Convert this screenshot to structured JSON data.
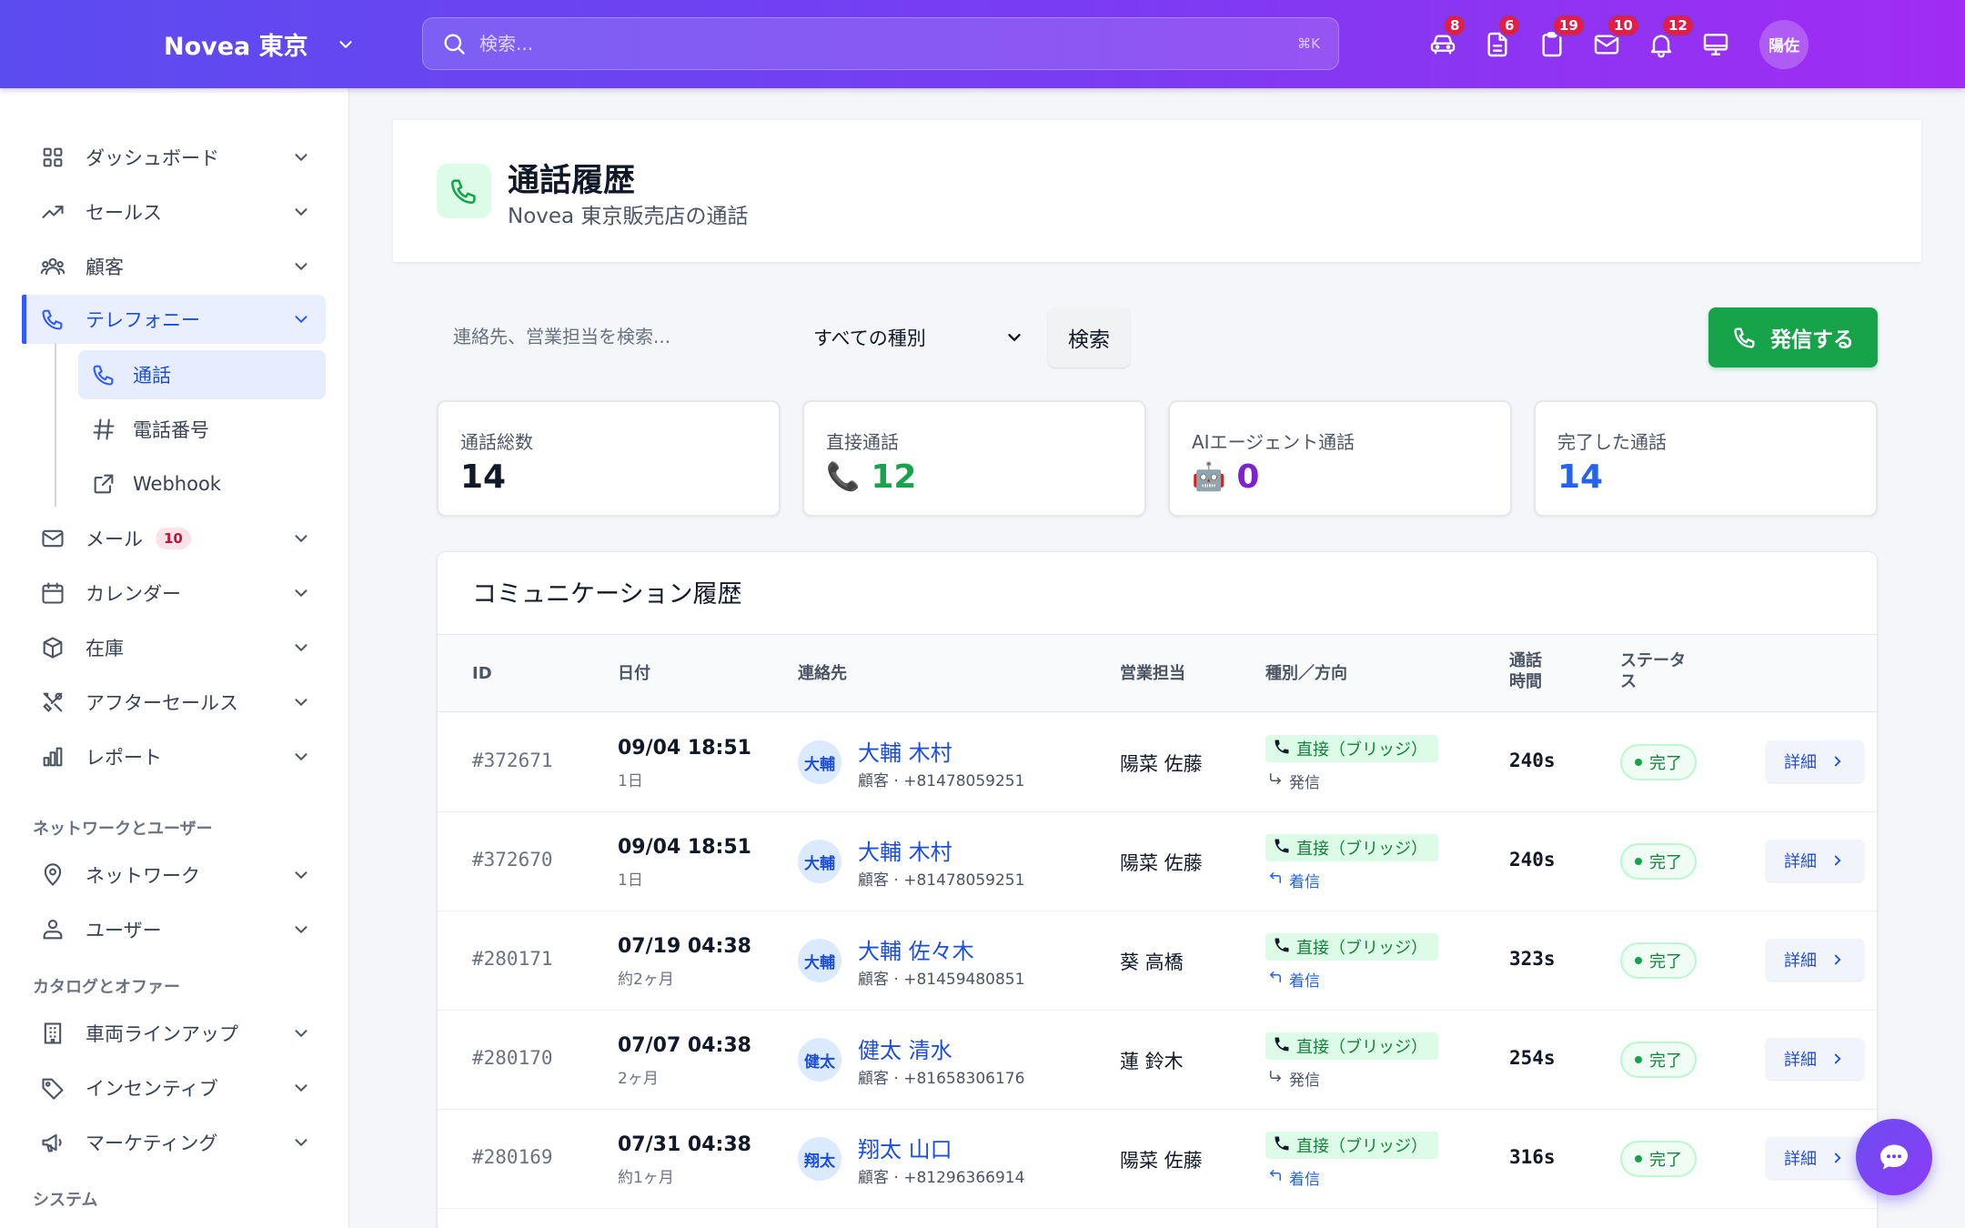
{
  "topbar": {
    "brand": "Novea 東京",
    "search_placeholder": "検索...",
    "shortcut": "⌘K",
    "icons": [
      {
        "name": "car-icon",
        "badge": "8"
      },
      {
        "name": "document-icon",
        "badge": "6"
      },
      {
        "name": "clipboard-icon",
        "badge": "19"
      },
      {
        "name": "mail-icon",
        "badge": "10"
      },
      {
        "name": "bell-icon",
        "badge": "12"
      },
      {
        "name": "monitor-icon",
        "badge": ""
      }
    ],
    "user_initials": "陽佐"
  },
  "sidebar": {
    "items": [
      {
        "label": "ダッシュボード",
        "icon": "grid-icon"
      },
      {
        "label": "セールス",
        "icon": "trending-up-icon"
      },
      {
        "label": "顧客",
        "icon": "users-icon"
      },
      {
        "label": "テレフォニー",
        "icon": "phone-icon",
        "active": true
      },
      {
        "label": "メール",
        "icon": "mail-icon",
        "badge": "10"
      },
      {
        "label": "カレンダー",
        "icon": "calendar-icon"
      },
      {
        "label": "在庫",
        "icon": "box-icon"
      },
      {
        "label": "アフターセールス",
        "icon": "tools-icon"
      },
      {
        "label": "レポート",
        "icon": "bar-chart-icon"
      },
      {
        "label": "ネットワーク",
        "icon": "map-pin-icon"
      },
      {
        "label": "ユーザー",
        "icon": "user-group-icon"
      },
      {
        "label": "車両ラインアップ",
        "icon": "building-icon"
      },
      {
        "label": "インセンティブ",
        "icon": "tag-icon"
      },
      {
        "label": "マーケティング",
        "icon": "megaphone-icon"
      }
    ],
    "sub_items": [
      {
        "label": "通話",
        "icon": "phone-icon",
        "active": true
      },
      {
        "label": "電話番号",
        "icon": "hash-icon"
      },
      {
        "label": "Webhook",
        "icon": "external-link-icon"
      }
    ],
    "sections": [
      "ネットワークとユーザー",
      "カタログとオファー",
      "システム"
    ]
  },
  "page": {
    "title": "通話履歴",
    "subtitle": "Novea 東京販売店の通話"
  },
  "filters": {
    "search_placeholder": "連絡先、営業担当を検索...",
    "type_select": "すべての種別",
    "search_button": "検索",
    "call_button": "発信する"
  },
  "stats": [
    {
      "label": "通話総数",
      "value": "14",
      "color": "#111827",
      "emoji": ""
    },
    {
      "label": "直接通話",
      "value": "12",
      "color": "#16a34a",
      "emoji": "📞"
    },
    {
      "label": "AIエージェント通話",
      "value": "0",
      "color": "#7e22ce",
      "emoji": "🤖"
    },
    {
      "label": "完了した通話",
      "value": "14",
      "color": "#2563eb",
      "emoji": ""
    }
  ],
  "table": {
    "title": "コミュニケーション履歴",
    "headers": {
      "id": "ID",
      "date": "日付",
      "contact": "連絡先",
      "agent": "営業担当",
      "type": "種別／方向",
      "duration_1": "通話",
      "duration_2": "時間",
      "status_1": "ステータ",
      "status_2": "ス"
    },
    "rows": [
      {
        "id": "#372671",
        "date": "09/04 18:51",
        "ago": "1日",
        "initials": "大輔",
        "name": "大輔 木村",
        "phone": "顧客 · +81478059251",
        "agent": "陽菜 佐藤",
        "type": "直接（ブリッジ）",
        "direction": "発信",
        "dir": "out",
        "duration": "240s",
        "status": "完了",
        "detail": "詳細"
      },
      {
        "id": "#372670",
        "date": "09/04 18:51",
        "ago": "1日",
        "initials": "大輔",
        "name": "大輔 木村",
        "phone": "顧客 · +81478059251",
        "agent": "陽菜 佐藤",
        "type": "直接（ブリッジ）",
        "direction": "着信",
        "dir": "in",
        "duration": "240s",
        "status": "完了",
        "detail": "詳細"
      },
      {
        "id": "#280171",
        "date": "07/19 04:38",
        "ago": "約2ヶ月",
        "initials": "大輔",
        "name": "大輔 佐々木",
        "phone": "顧客 · +81459480851",
        "agent": "葵 高橋",
        "type": "直接（ブリッジ）",
        "direction": "着信",
        "dir": "in",
        "duration": "323s",
        "status": "完了",
        "detail": "詳細"
      },
      {
        "id": "#280170",
        "date": "07/07 04:38",
        "ago": "2ヶ月",
        "initials": "健太",
        "name": "健太 清水",
        "phone": "顧客 · +81658306176",
        "agent": "蓮 鈴木",
        "type": "直接（ブリッジ）",
        "direction": "発信",
        "dir": "out",
        "duration": "254s",
        "status": "完了",
        "detail": "詳細"
      },
      {
        "id": "#280169",
        "date": "07/31 04:38",
        "ago": "約1ヶ月",
        "initials": "翔太",
        "name": "翔太 山口",
        "phone": "顧客 · +81296366914",
        "agent": "陽菜 佐藤",
        "type": "直接（ブリッジ）",
        "direction": "着信",
        "dir": "in",
        "duration": "316s",
        "status": "完了",
        "detail": "詳細"
      }
    ]
  }
}
